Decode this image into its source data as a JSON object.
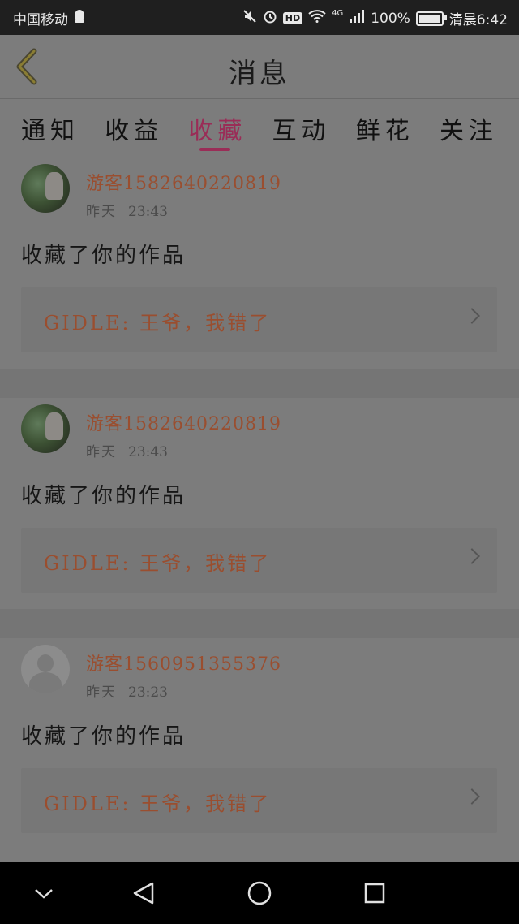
{
  "status_bar": {
    "carrier": "中国移动",
    "hd_badge": "HD",
    "network": "4G",
    "battery_percent": "100%",
    "battery_level": 1.0,
    "time": "清晨6:42"
  },
  "header": {
    "title": "消息"
  },
  "tabs": [
    {
      "label": "通知",
      "active": false
    },
    {
      "label": "收益",
      "active": false
    },
    {
      "label": "收藏",
      "active": true
    },
    {
      "label": "互动",
      "active": false
    },
    {
      "label": "鲜花",
      "active": false
    },
    {
      "label": "关注",
      "active": false
    }
  ],
  "notifications": [
    {
      "username": "游客1582640220819",
      "day": "昨天",
      "clock": "23:43",
      "action": "收藏了你的作品",
      "work_title": "GIDLE: 王爷，我错了",
      "avatar": "photo"
    },
    {
      "username": "游客1582640220819",
      "day": "昨天",
      "clock": "23:43",
      "action": "收藏了你的作品",
      "work_title": "GIDLE: 王爷，我错了",
      "avatar": "photo"
    },
    {
      "username": "游客1560951355376",
      "day": "昨天",
      "clock": "23:23",
      "action": "收藏了你的作品",
      "work_title": "GIDLE: 王爷，我错了",
      "avatar": "default"
    }
  ],
  "colors": {
    "accent": "#9a2d57",
    "username": "#9a4e2f",
    "overlay_bg": "#7c7c7c"
  }
}
